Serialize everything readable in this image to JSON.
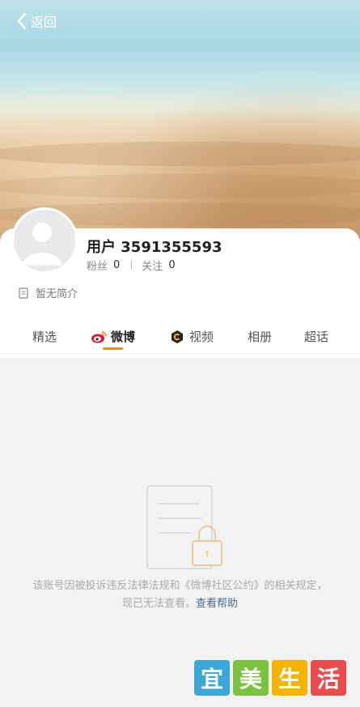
{
  "nav": {
    "back_label": "返回"
  },
  "profile": {
    "username": "用户 3591355593",
    "followers_label": "粉丝",
    "followers_count": "0",
    "following_label": "关注",
    "following_count": "0",
    "intro": "暂无简介"
  },
  "tabs": [
    {
      "label": "精选",
      "active": false
    },
    {
      "label": "微博",
      "active": true,
      "icon": "weibo-icon"
    },
    {
      "label": "视频",
      "active": false,
      "icon": "video-icon"
    },
    {
      "label": "相册",
      "active": false
    },
    {
      "label": "超话",
      "active": false
    }
  ],
  "notice": {
    "text": "该账号因被投诉违反法律法规和《微博社区公约》的相关规定，现已无法查看。",
    "link": "查看帮助"
  },
  "watermark": {
    "chars": [
      "宜",
      "美",
      "生",
      "活"
    ],
    "colors": [
      "#3aa7d8",
      "#7cc242",
      "#f5b400",
      "#e84c4c"
    ]
  },
  "colors": {
    "accent": "#f08a24",
    "link": "#4a6b93"
  }
}
